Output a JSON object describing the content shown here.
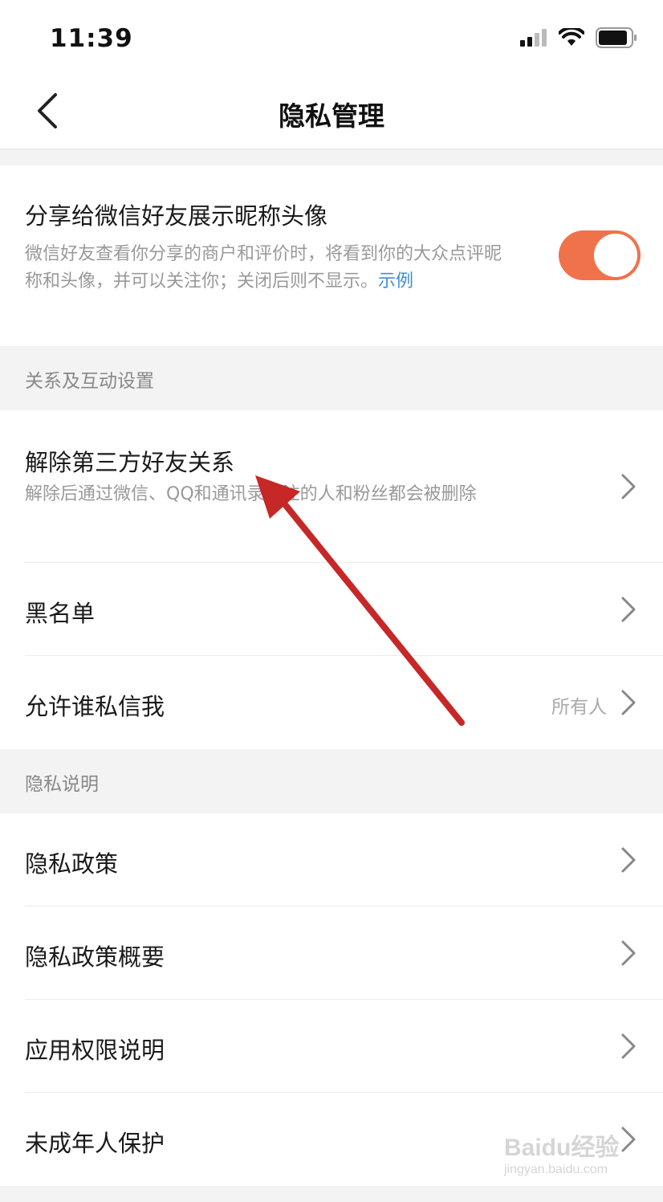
{
  "status_bar": {
    "time": "11:39",
    "icons": [
      "signal-icon",
      "wifi-icon",
      "battery-icon"
    ]
  },
  "nav": {
    "title": "隐私管理",
    "back_icon": "chevron-left-icon"
  },
  "share_setting": {
    "title": "分享给微信好友展示昵称头像",
    "description": "微信好友查看你分享的商户和评价时，将看到你的大众点评昵称和头像，并可以关注你；关闭后则不显示。",
    "example_link": "示例",
    "toggle_on": true
  },
  "sections": [
    {
      "header": "关系及互动设置",
      "items": [
        {
          "label": "解除第三方好友关系",
          "description": "解除后通过微信、QQ和通讯录关注的人和粉丝都会被删除"
        },
        {
          "label": "黑名单"
        },
        {
          "label": "允许谁私信我",
          "value": "所有人"
        }
      ]
    },
    {
      "header": "隐私说明",
      "items": [
        {
          "label": "隐私政策"
        },
        {
          "label": "隐私政策概要"
        },
        {
          "label": "应用权限说明"
        },
        {
          "label": "未成年人保护"
        }
      ]
    }
  ],
  "watermark": {
    "brand": "Baidu经验",
    "url": "jingyan.baidu.com"
  },
  "colors": {
    "toggle_on": "#f0724b",
    "link": "#3e8ed6",
    "annotation_arrow": "#c62828"
  }
}
